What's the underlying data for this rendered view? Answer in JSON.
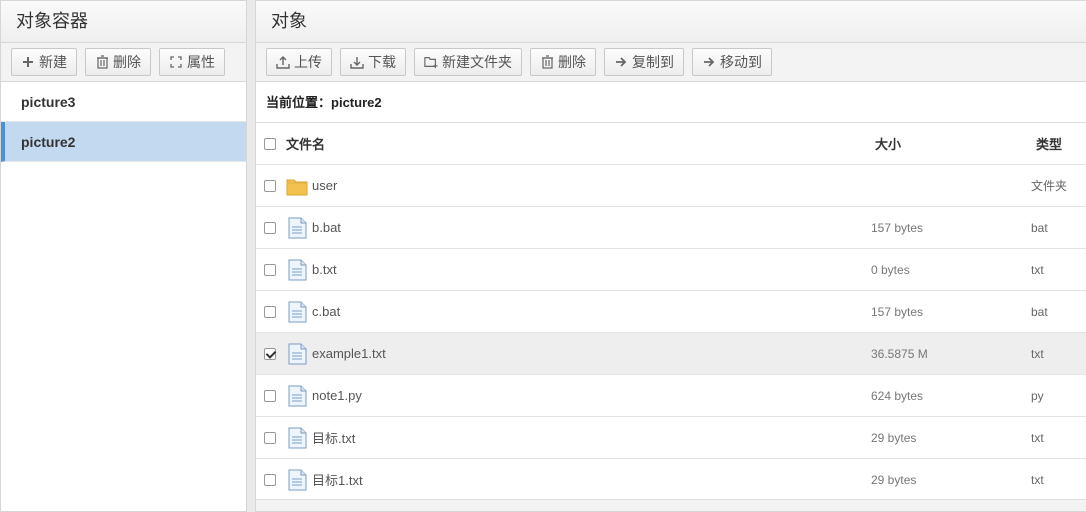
{
  "left_panel": {
    "title": "对象容器",
    "toolbar": {
      "new_label": "新建",
      "delete_label": "删除",
      "props_label": "属性"
    },
    "containers": [
      {
        "name": "picture3",
        "active": false
      },
      {
        "name": "picture2",
        "active": true
      }
    ]
  },
  "right_panel": {
    "title": "对象",
    "toolbar": {
      "upload_label": "上传",
      "download_label": "下载",
      "new_folder_label": "新建文件夹",
      "delete_label": "删除",
      "copy_label": "复制到",
      "move_label": "移动到"
    },
    "location_label": "当前位置：",
    "location_value": "picture2",
    "columns": {
      "name": "文件名",
      "size": "大小",
      "type": "类型"
    },
    "files": [
      {
        "name": "user",
        "size": "",
        "type": "文件夹",
        "icon": "folder-icon",
        "checked": false
      },
      {
        "name": "b.bat",
        "size": "157 bytes",
        "type": "bat",
        "icon": "file-icon",
        "checked": false
      },
      {
        "name": "b.txt",
        "size": "0 bytes",
        "type": "txt",
        "icon": "file-icon",
        "checked": false
      },
      {
        "name": "c.bat",
        "size": "157 bytes",
        "type": "bat",
        "icon": "file-icon",
        "checked": false
      },
      {
        "name": "example1.txt",
        "size": "36.5875 M",
        "type": "txt",
        "icon": "file-icon",
        "checked": true
      },
      {
        "name": "note1.py",
        "size": "624 bytes",
        "type": "py",
        "icon": "file-icon",
        "checked": false
      },
      {
        "name": "目标.txt",
        "size": "29 bytes",
        "type": "txt",
        "icon": "file-icon",
        "checked": false
      },
      {
        "name": "目标1.txt",
        "size": "29 bytes",
        "type": "txt",
        "icon": "file-icon",
        "checked": false
      }
    ]
  },
  "colors": {
    "accent": "#4a90d9",
    "selected_bg": "#c3d9ef",
    "folder": "#f2c14e"
  }
}
